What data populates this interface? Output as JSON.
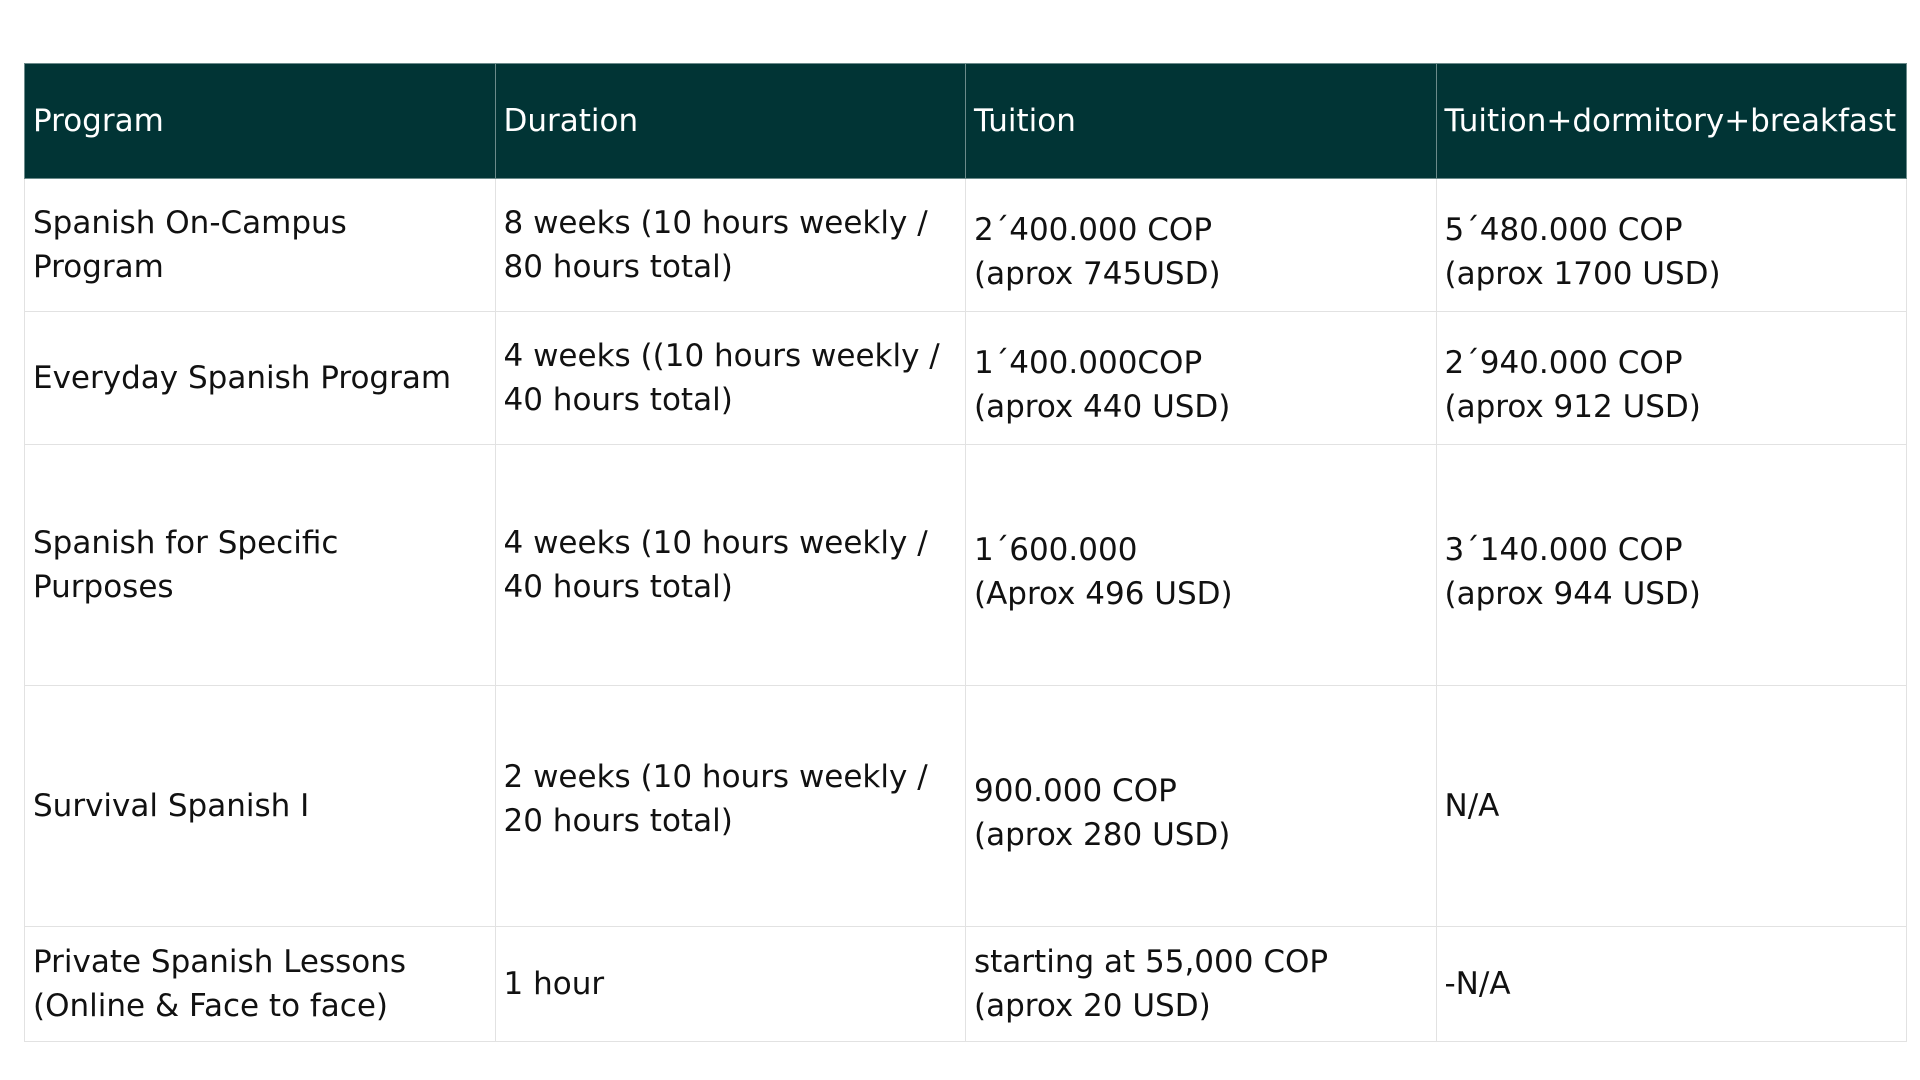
{
  "table": {
    "headers": [
      "Program",
      "Duration",
      "Tuition",
      "Tuition+dormitory+breakfast"
    ],
    "rows": [
      {
        "program": [
          "Spanish On-Campus",
          "Program"
        ],
        "duration": [
          "8 weeks (10 hours weekly /",
          "80 hours total)"
        ],
        "tuition": [
          "2´400.000 COP",
          "(aprox 745USD)"
        ],
        "full": [
          "5´480.000 COP",
          "(aprox 1700 USD)"
        ]
      },
      {
        "program": [
          "Everyday Spanish Program"
        ],
        "duration": [
          "4 weeks ((10 hours weekly /",
          "40 hours total)"
        ],
        "tuition": [
          "1´400.000COP",
          "(aprox 440 USD)"
        ],
        "full": [
          "2´940.000 COP",
          "(aprox 912 USD)"
        ]
      },
      {
        "program": [
          "Spanish for Specific",
          "Purposes"
        ],
        "duration": [
          "4 weeks (10 hours weekly /",
          "40 hours total)"
        ],
        "tuition": [
          "1´600.000",
          "(Aprox 496 USD)"
        ],
        "full": [
          "3´140.000 COP",
          "(aprox 944 USD)"
        ]
      },
      {
        "program": [
          "Survival Spanish I"
        ],
        "duration": [
          "2 weeks (10 hours weekly /",
          "20 hours total)"
        ],
        "tuition": [
          "900.000 COP",
          "(aprox 280 USD)"
        ],
        "full": [
          "N/A"
        ]
      },
      {
        "program": [
          "Private Spanish Lessons",
          "(Online & Face to face)"
        ],
        "duration": [
          "1 hour"
        ],
        "tuition": [
          "starting at 55,000 COP",
          "(aprox 20 USD)"
        ],
        "full": [
          "-N/A"
        ]
      }
    ]
  },
  "colors": {
    "header_background": "#013435",
    "header_text": "#ffffff",
    "border": "#e2e2e2"
  }
}
